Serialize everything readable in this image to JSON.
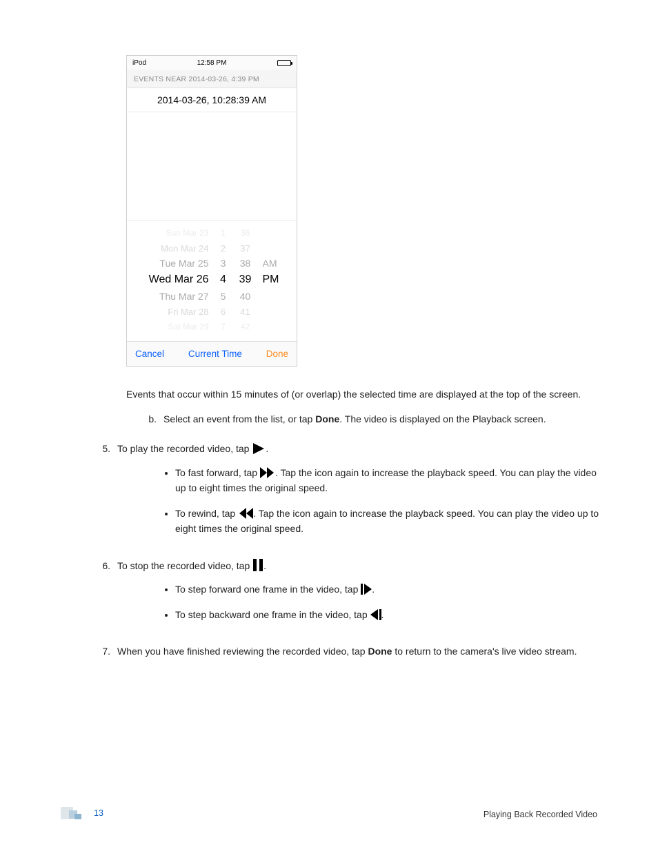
{
  "screenshot": {
    "statusbar": {
      "left": "iPod",
      "time": "12:58 PM"
    },
    "eventsHeader": "EVENTS NEAR 2014-03-26, 4:39 PM",
    "eventRow": "2014-03-26, 10:28:39 AM",
    "picker": {
      "rows": [
        {
          "cls": "r-3",
          "day": "Sun Mar 23",
          "h": "1",
          "m": "36",
          "ap": ""
        },
        {
          "cls": "r-2",
          "day": "Mon Mar 24",
          "h": "2",
          "m": "37",
          "ap": ""
        },
        {
          "cls": "r-1",
          "day": "Tue Mar 25",
          "h": "3",
          "m": "38",
          "ap": "AM"
        },
        {
          "cls": "sel",
          "day": "Wed Mar 26",
          "h": "4",
          "m": "39",
          "ap": "PM"
        },
        {
          "cls": "r1",
          "day": "Thu Mar 27",
          "h": "5",
          "m": "40",
          "ap": ""
        },
        {
          "cls": "r2",
          "day": "Fri Mar 28",
          "h": "6",
          "m": "41",
          "ap": ""
        },
        {
          "cls": "r3",
          "day": "Sat Mar 29",
          "h": "7",
          "m": "42",
          "ap": ""
        }
      ]
    },
    "toolbar": {
      "cancel": "Cancel",
      "current": "Current Time",
      "done": "Done"
    }
  },
  "text": {
    "note": "Events that occur within 15 minutes of (or overlap) the selected time are displayed at the top of the screen.",
    "b_pre": "Select an event from the list, or tap ",
    "b_bold": "Done",
    "b_post": ". The video is displayed on the Playback screen.",
    "step5_pre": "To play the recorded video, tap ",
    "ff_pre": "To fast forward, tap ",
    "ff_post": ". Tap the icon again to increase the playback speed. You can play the video up to eight times the original speed.",
    "rw_pre": "To rewind, tap ",
    "rw_post": ". Tap the icon again to increase the playback speed. You can play the video up to eight times the original speed.",
    "step6_pre": "To stop the recorded video, tap ",
    "stepfwd_pre": "To step forward one frame in the video, tap ",
    "stepback_pre": "To step backward one frame in the video, tap ",
    "step7_pre": "When you have finished reviewing the recorded video, tap ",
    "step7_bold": "Done",
    "step7_post": " to return to the camera's live video stream.",
    "period": "."
  },
  "nums": {
    "n5": "5.",
    "n6": "6.",
    "n7": "7.",
    "b": "b."
  },
  "footer": {
    "page": "13",
    "title": "Playing Back Recorded Video"
  }
}
